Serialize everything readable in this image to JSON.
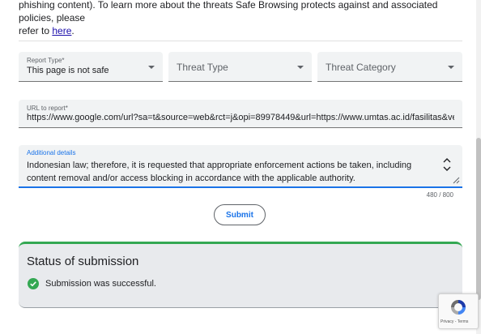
{
  "intro": {
    "line1": "phishing content). To learn more about the threats Safe Browsing protects against and associated policies, please",
    "line2_prefix": "refer to ",
    "link": "here",
    "line2_suffix": "."
  },
  "form": {
    "report_type": {
      "label": "Report Type*",
      "value": "This page is not safe"
    },
    "threat_type": {
      "placeholder": "Threat Type"
    },
    "threat_category": {
      "placeholder": "Threat Category"
    },
    "url": {
      "label": "URL to report*",
      "value": "https://www.google.com/url?sa=t&source=web&rct=j&opi=89978449&url=https://www.umtas.ac.id/fasilitas&ve"
    },
    "details": {
      "label": "Additional details",
      "value": "Indonesian law; therefore, it is requested that appropriate enforcement actions be taken, including content removal and/or access blocking in accordance with the applicable authority.",
      "counter": "480 / 800"
    },
    "submit_label": "Submit"
  },
  "status": {
    "title": "Status of submission",
    "message": "Submission was successful.",
    "accent_color": "#34a853"
  },
  "recaptcha": {
    "links": "Privacy - Terms"
  }
}
